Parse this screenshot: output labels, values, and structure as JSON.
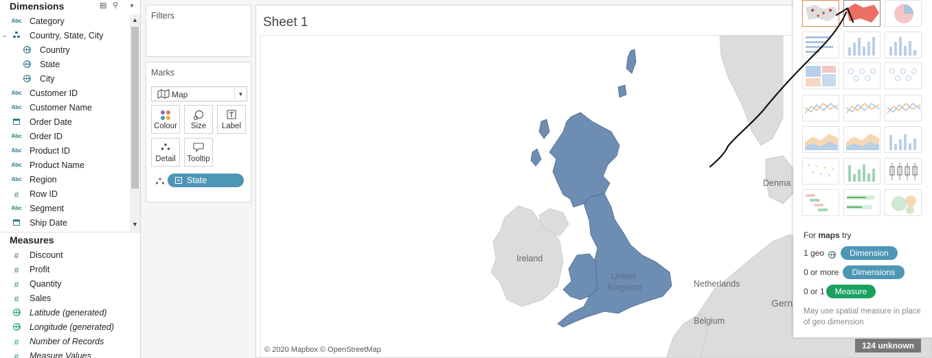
{
  "data_pane": {
    "dimensions_title": "Dimensions",
    "measures_title": "Measures",
    "dimensions": [
      {
        "icon": "abc",
        "label": "Category"
      },
      {
        "icon": "hierarchy",
        "label": "Country, State, City"
      },
      {
        "icon": "globe",
        "label": "Country"
      },
      {
        "icon": "globe",
        "label": "State"
      },
      {
        "icon": "globe",
        "label": "City"
      },
      {
        "icon": "abc",
        "label": "Customer ID"
      },
      {
        "icon": "abc",
        "label": "Customer Name"
      },
      {
        "icon": "calendar",
        "label": "Order Date"
      },
      {
        "icon": "abc",
        "label": "Order ID"
      },
      {
        "icon": "abc",
        "label": "Product ID"
      },
      {
        "icon": "abc",
        "label": "Product Name"
      },
      {
        "icon": "abc",
        "label": "Region"
      },
      {
        "icon": "hash",
        "label": "Row ID"
      },
      {
        "icon": "abc",
        "label": "Segment"
      },
      {
        "icon": "calendar",
        "label": "Ship Date"
      }
    ],
    "measures": [
      {
        "icon": "hash",
        "label": "Discount"
      },
      {
        "icon": "hash",
        "label": "Profit"
      },
      {
        "icon": "hash",
        "label": "Quantity"
      },
      {
        "icon": "hash",
        "label": "Sales"
      },
      {
        "icon": "globe",
        "label": "Latitude (generated)"
      },
      {
        "icon": "globe",
        "label": "Longitude (generated)"
      },
      {
        "icon": "hash",
        "label": "Number of Records"
      },
      {
        "icon": "hash",
        "label": "Measure Values"
      }
    ]
  },
  "shelves": {
    "filters_title": "Filters",
    "marks_title": "Marks",
    "mark_type": "Map",
    "buttons": {
      "colour": "Colour",
      "size": "Size",
      "label": "Label",
      "detail": "Detail",
      "tooltip": "Tooltip"
    },
    "detail_pill": "State"
  },
  "view": {
    "sheet_title": "Sheet 1",
    "map_labels": {
      "ireland": "Ireland",
      "uk_line1": "United",
      "uk_line2": "Kingdom",
      "netherlands": "Netherlands",
      "belgium": "Belgium",
      "denmark": "Denma",
      "germany": "Gern"
    },
    "copyright": "© 2020 Mapbox © OpenStreetMap",
    "unknown_badge": "124 unknown"
  },
  "show_me": {
    "hint_prefix": "For",
    "hint_bold": "maps",
    "hint_suffix": "try",
    "rows": [
      {
        "prefix": "1 geo",
        "pill": "Dimension"
      },
      {
        "prefix": "0 or more",
        "pill": "Dimensions"
      },
      {
        "prefix": "0 or 1",
        "pill": "Measure"
      }
    ],
    "note": "May use spatial measure in place of geo dimension"
  },
  "colors": {
    "state_fill": "#6e8db3",
    "pill_dimension": "#4d96b5",
    "pill_measure": "#19a15e",
    "selected_thumb_border": "#e2874a"
  }
}
